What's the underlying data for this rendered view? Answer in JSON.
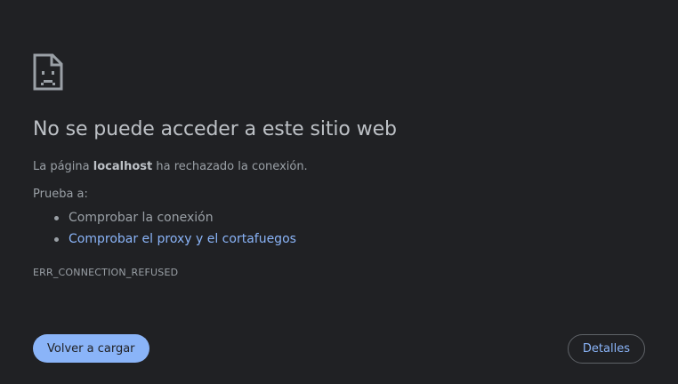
{
  "error_page": {
    "icon": "sad-page-icon",
    "title": "No se puede acceder a este sitio web",
    "description": {
      "prefix": "La página ",
      "host": "localhost",
      "suffix": " ha rechazado la conexión."
    },
    "try_label": "Prueba a:",
    "suggestions": [
      {
        "text": "Comprobar la conexión",
        "is_link": false
      },
      {
        "text": "Comprobar el proxy y el cortafuegos",
        "is_link": true
      }
    ],
    "error_code": "ERR_CONNECTION_REFUSED",
    "reload_button_label": "Volver a cargar",
    "details_button_label": "Detalles"
  },
  "colors": {
    "background": "#202124",
    "accent": "#8ab4f8",
    "title": "#bdc1c6",
    "text": "#9aa0a6"
  }
}
